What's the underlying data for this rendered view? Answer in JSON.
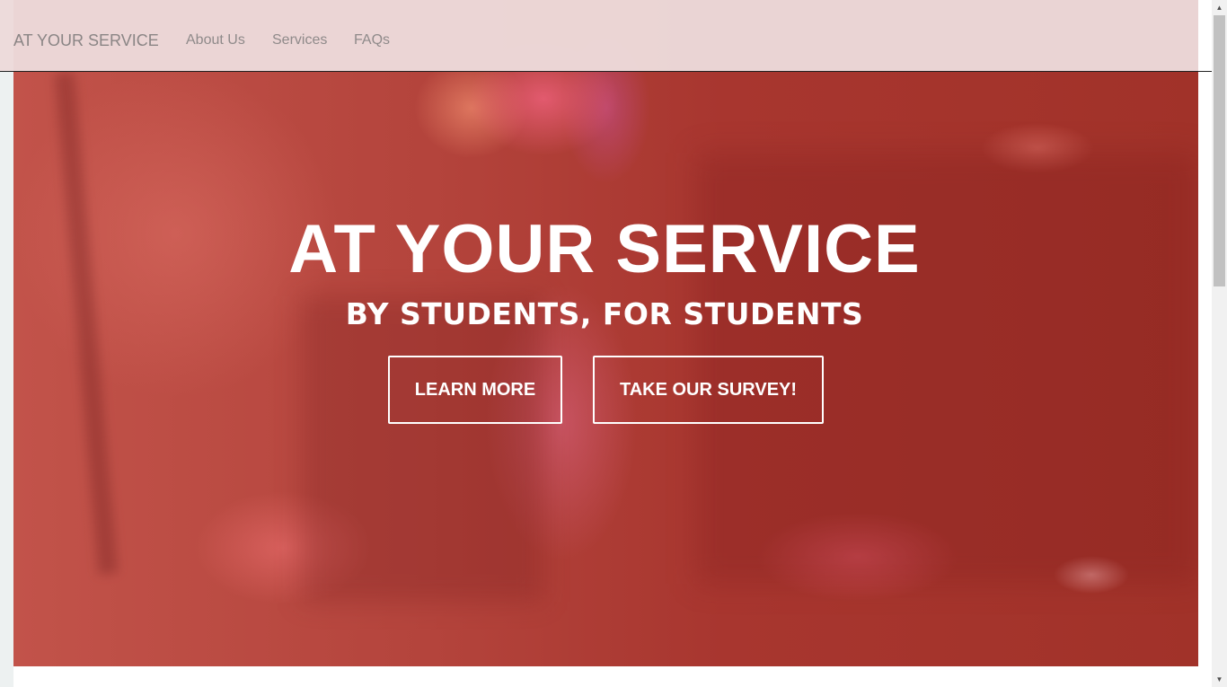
{
  "navbar": {
    "brand": "AT YOUR SERVICE",
    "links": [
      "About Us",
      "Services",
      "FAQs"
    ]
  },
  "hero": {
    "title": "AT YOUR SERVICE",
    "subtitle": "BY STUDENTS, FOR STUDENTS",
    "buttons": {
      "learn_more": "LEARN MORE",
      "survey": "TAKE OUR SURVEY!"
    }
  },
  "scrollbar": {
    "up_icon": "▲",
    "down_icon": "▼"
  },
  "colors": {
    "hero_overlay": "#a8352e",
    "navbar_bg": "#ecdada",
    "nav_text": "#8f8a8a",
    "button_border": "#ffffff"
  }
}
